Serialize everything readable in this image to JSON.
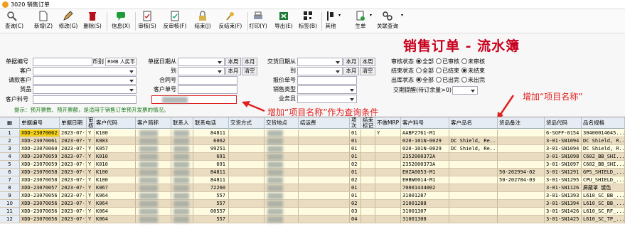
{
  "window": {
    "title": "3020 销售订单"
  },
  "toolbar": [
    {
      "label": "查询(C)",
      "icon": "search-icon"
    },
    {
      "label": "新增(Z)",
      "icon": "new-doc-icon"
    },
    {
      "label": "修改(G)",
      "icon": "edit-icon"
    },
    {
      "label": "删除(S)",
      "icon": "trash-icon"
    },
    {
      "label": "信息(X)",
      "icon": "chat-icon"
    },
    {
      "label": "审核(S)",
      "icon": "approve-icon"
    },
    {
      "label": "反审核(F)",
      "icon": "unapprove-icon"
    },
    {
      "label": "结束(J)",
      "icon": "lock-icon"
    },
    {
      "label": "反结束(F)",
      "icon": "key-icon"
    },
    {
      "label": "打印(Y)",
      "icon": "printer-icon"
    },
    {
      "label": "导出(E)",
      "icon": "excel-icon"
    },
    {
      "label": "标签(B)",
      "icon": "qrcode-icon"
    },
    {
      "label": "其他",
      "icon": "more-icon"
    },
    {
      "label": "生单",
      "icon": "gen-doc-icon"
    },
    {
      "label": "关联查询",
      "icon": "link-icon"
    }
  ],
  "heading": "销售订单 - 流水簿",
  "filters": {
    "doc_no": "单据编号",
    "currency": "币别",
    "currency_value": "RMB 人民币",
    "date_from": "单据日期从",
    "date_to": "到",
    "this_week": "本周",
    "this_month": "本月",
    "clear": "清空",
    "deliv_from": "交货日期从",
    "deliv_to": "到",
    "customer": "客户",
    "request_customer": "请款客户",
    "product": "货品",
    "customer_item_no": "客户料号",
    "contract_no": "合同号",
    "customer_order_no": "客户单号",
    "quote_no": "报价单号",
    "sales_type": "销售类型",
    "salesman": "业务员",
    "project_name_value": "",
    "audit_status": "审核状态",
    "end_status": "结束状态",
    "outbound_status": "出库状态",
    "delivery_reminder": "交期提醒(待订余量>0)",
    "opt_all": "全部",
    "opt_audited": "已审核",
    "opt_unaudited": "未审核",
    "opt_ended": "已结束",
    "opt_unended": "未结束",
    "opt_outbound_done": "已出完",
    "opt_outbound_undone": "未出完"
  },
  "hint": "提示：预开票数、预开票额，是适用于销售订单预开发票的情况。",
  "annotations": {
    "query_condition": "增加“项目名称”作为查询条件",
    "column": "增加“项目名称”"
  },
  "grid": {
    "columns": [
      "单据编号",
      "单据日期",
      "审核",
      "客户代码",
      "客户简称",
      "联系人",
      "联系电话",
      "交货方式",
      "交货地点",
      "结运费",
      "项次",
      "结束标记",
      "不做MRP",
      "客户料号",
      "客户品名",
      "货品备注",
      "货品代码",
      "品名规格"
    ],
    "rows": [
      {
        "n": "1",
        "no": "XDD-23070062",
        "date": "2023-07-19",
        "ok": "Y",
        "code": "K100",
        "phone": "84811",
        "item": "01",
        "nomrp": "Y",
        "cpn": "AABF2761-M1",
        "cname": "",
        "remark": "",
        "pcode": "6-SGFF-0154",
        "spec": "30400014645..."
      },
      {
        "n": "2",
        "no": "XDD-23070061",
        "date": "2023-07-19",
        "ok": "Y",
        "code": "K083",
        "phone": "6062",
        "item": "01",
        "nomrp": "",
        "cpn": "020-101N-0029",
        "cname": "DC Shield, Re...",
        "remark": "",
        "pcode": "3-01-SN1094",
        "spec": "DC Shield, R..."
      },
      {
        "n": "3",
        "no": "XDD-23070060",
        "date": "2023-07-19",
        "ok": "Y",
        "code": "K057",
        "phone": "99251",
        "item": "01",
        "nomrp": "",
        "cpn": "020-101N-0029",
        "cname": "DC Shield, Re...",
        "remark": "",
        "pcode": "3-01-SN1094",
        "spec": "DC Shield, R..."
      },
      {
        "n": "4",
        "no": "XDD-23070059",
        "date": "2023-07-18",
        "ok": "Y",
        "code": "K010",
        "phone": "691",
        "item": "01",
        "nomrp": "",
        "cpn": "2352000372A",
        "cname": "",
        "remark": "",
        "pcode": "3-01-SN1098",
        "spec": "C602_BB_SHI..."
      },
      {
        "n": "5",
        "no": "XDD-23070059",
        "date": "2023-07-18",
        "ok": "Y",
        "code": "K010",
        "phone": "691",
        "item": "02",
        "nomrp": "",
        "cpn": "2352000373A",
        "cname": "",
        "remark": "",
        "pcode": "3-01-SN1097",
        "spec": "C602_BB_SHI..."
      },
      {
        "n": "6",
        "no": "XDD-23070058",
        "date": "2023-07-18",
        "ok": "Y",
        "code": "K100",
        "phone": "84811",
        "item": "01",
        "nomrp": "",
        "cpn": "EHZA0053-M1",
        "cname": "",
        "remark": "50-202994-02",
        "pcode": "3-01-SN1291",
        "spec": "GPS_SHIELD_..."
      },
      {
        "n": "7",
        "no": "XDD-23070058",
        "date": "2023-07-18",
        "ok": "Y",
        "code": "K100",
        "phone": "84811",
        "item": "02",
        "nomrp": "",
        "cpn": "EHBW0014-M1",
        "cname": "",
        "remark": "50-202784-03",
        "pcode": "3-01-SN1295",
        "spec": "CPU_SHIELD_..."
      },
      {
        "n": "8",
        "no": "XDD-23070057",
        "date": "2023-07-18",
        "ok": "Y",
        "code": "K067",
        "phone": "72260",
        "item": "01",
        "nomrp": "",
        "cpn": "70001434002",
        "cname": "",
        "remark": "",
        "pcode": "3-01-SN1126",
        "spec": "屏蔽罩 镀色"
      },
      {
        "n": "9",
        "no": "XDD-23070056",
        "date": "2023-07-18",
        "ok": "Y",
        "code": "K064",
        "phone": "557",
        "item": "01",
        "nomrp": "",
        "cpn": "31001287",
        "cname": "",
        "remark": "",
        "pcode": "3-01-SN1393",
        "spec": "L610_SC_BB_..."
      },
      {
        "n": "10",
        "no": "XDD-23070056",
        "date": "2023-07-18",
        "ok": "Y",
        "code": "K064",
        "phone": "557",
        "item": "02",
        "nomrp": "",
        "cpn": "31001288",
        "cname": "",
        "remark": "",
        "pcode": "3-01-SN1394",
        "spec": "L610_SC_BB_..."
      },
      {
        "n": "11",
        "no": "XDD-23070056",
        "date": "2023-07-18",
        "ok": "Y",
        "code": "K064",
        "phone": "00557",
        "item": "03",
        "nomrp": "",
        "cpn": "31001307",
        "cname": "",
        "remark": "",
        "pcode": "3-01-SN1426",
        "spec": "L610_SC_RF_..."
      },
      {
        "n": "12",
        "no": "XDD-23070056",
        "date": "2023-07-18",
        "ok": "Y",
        "code": "K064",
        "phone": "557",
        "item": "04",
        "nomrp": "",
        "cpn": "31001308",
        "cname": "",
        "remark": "",
        "pcode": "3-01-SN1425",
        "spec": "L610_SC_TP_..."
      }
    ]
  },
  "colors": {
    "heading": "#c8001e",
    "row_a": "#fffbe0",
    "row_b": "#e9dcc0",
    "selected": "#f5d21a",
    "annotation": "#e02020",
    "hint": "#1a7a1a"
  }
}
